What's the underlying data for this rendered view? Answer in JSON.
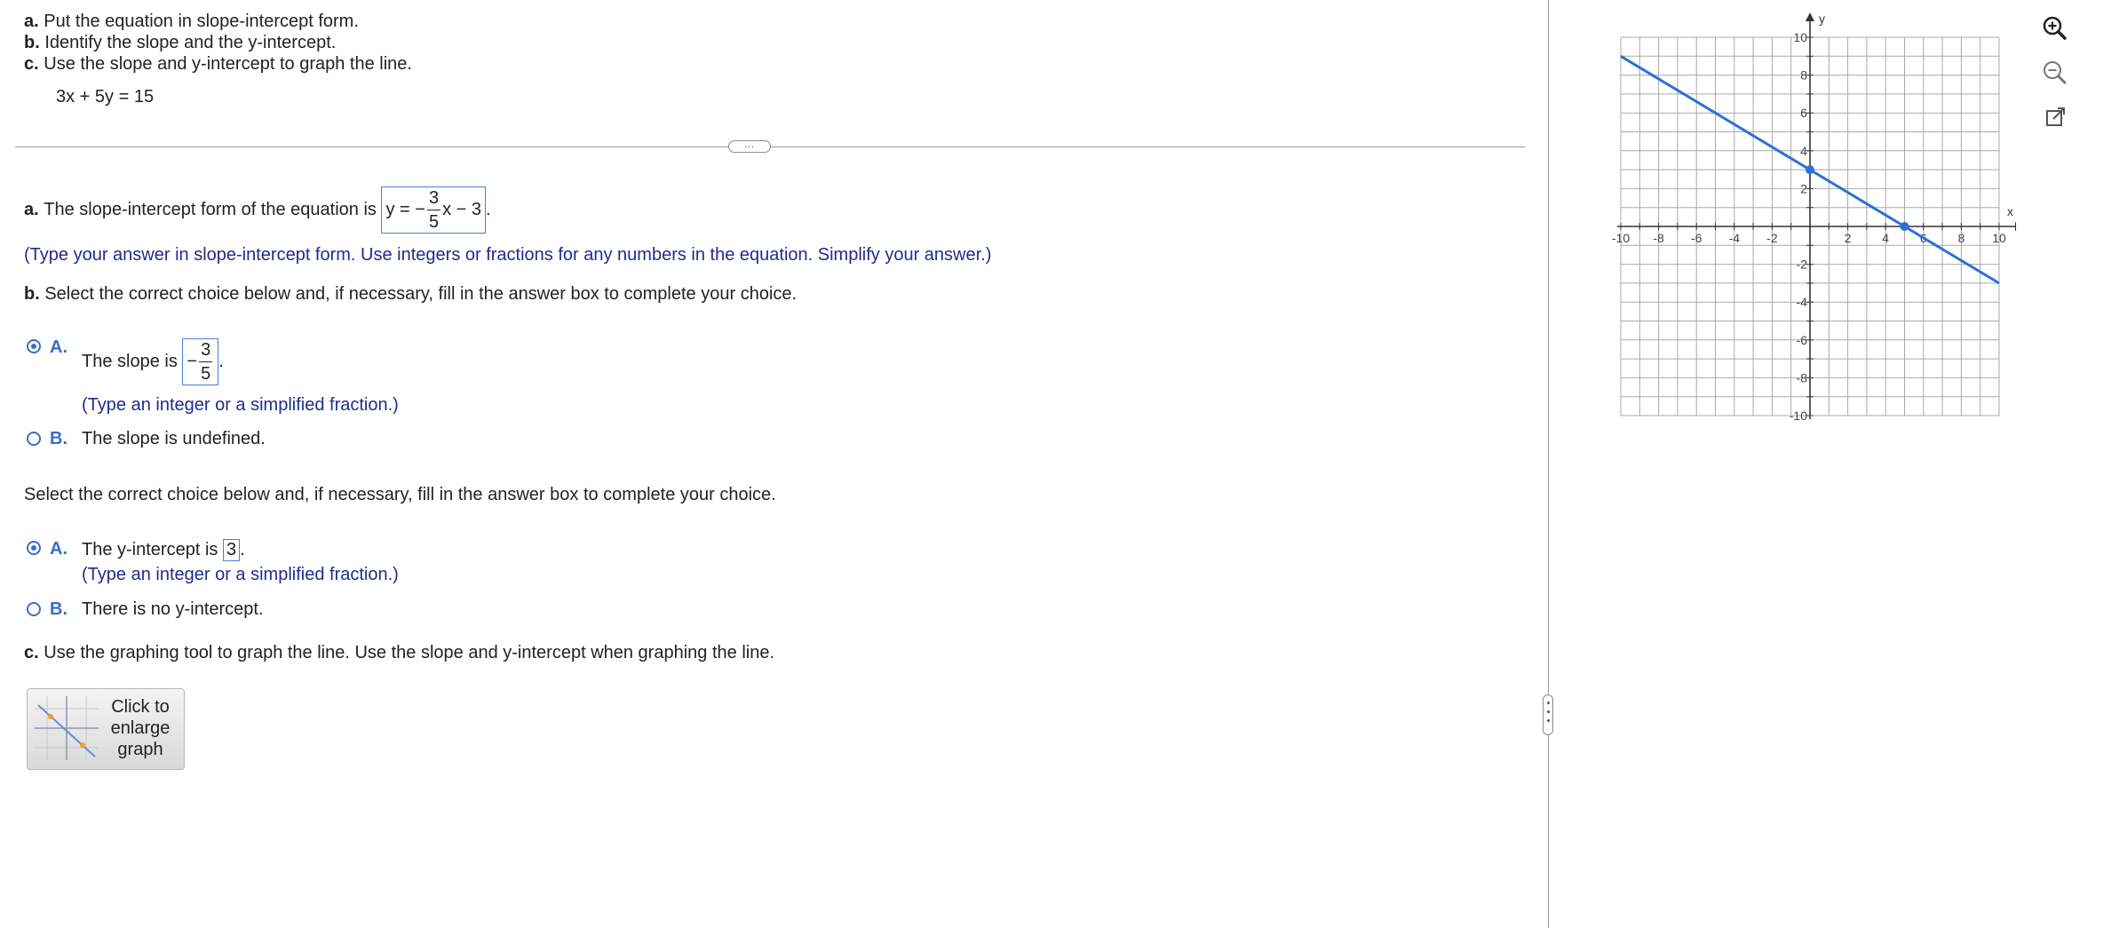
{
  "instructions": {
    "a_letter": "a.",
    "a_text": "Put the equation in slope-intercept form.",
    "b_letter": "b.",
    "b_text": "Identify the slope and the y-intercept.",
    "c_letter": "c.",
    "c_text": "Use the slope and y-intercept to graph the line."
  },
  "equation": "3x + 5y = 15",
  "part_a": {
    "letter": "a.",
    "text": "The slope-intercept form of the equation is",
    "answer": {
      "prefix": "y = −",
      "num": "3",
      "den": "5",
      "suffix": "x − 3"
    },
    "hint": "(Type your answer in slope-intercept form. Use integers or fractions for any numbers in the equation. Simplify your answer.)"
  },
  "part_b": {
    "letter": "b.",
    "prompt": "Select the correct choice below and, if necessary, fill in the answer box to complete your choice.",
    "slope_options": [
      {
        "letter": "A.",
        "text": "The slope is",
        "answer": {
          "sign": "−",
          "num": "3",
          "den": "5"
        },
        "hint": "(Type an integer or a simplified fraction.)"
      },
      {
        "letter": "B.",
        "text": "The slope is undefined."
      }
    ],
    "prompt2": "Select the correct choice below and, if necessary, fill in the answer box to complete your choice.",
    "intercept_options": [
      {
        "letter": "A.",
        "text": "The y-intercept is",
        "answer": "3",
        "hint": "(Type an integer or a simplified fraction.)"
      },
      {
        "letter": "B.",
        "text": "There is no y-intercept."
      }
    ]
  },
  "part_c": {
    "letter": "c.",
    "text": "Use the graphing tool to graph the line. Use the slope and y-intercept when graphing the line."
  },
  "enlarge_button": {
    "line1": "Click to",
    "line2": "enlarge",
    "line3": "graph"
  },
  "graph": {
    "x_label": "x",
    "y_label": "y",
    "x_ticks": [
      "-10",
      "-8",
      "-6",
      "-4",
      "-2",
      "2",
      "4",
      "6",
      "8",
      "10"
    ],
    "y_ticks": [
      "10",
      "8",
      "6",
      "4",
      "2",
      "-2",
      "-4",
      "-6",
      "-8",
      "-10"
    ],
    "line_color": "#2f6fd6",
    "line": {
      "slope": -0.6,
      "intercept": 3
    },
    "points": [
      {
        "x": 0,
        "y": 3
      },
      {
        "x": 5,
        "y": 0
      }
    ]
  },
  "toolbar_icons": [
    "zoom-in-icon",
    "zoom-out-icon",
    "popout-icon"
  ]
}
